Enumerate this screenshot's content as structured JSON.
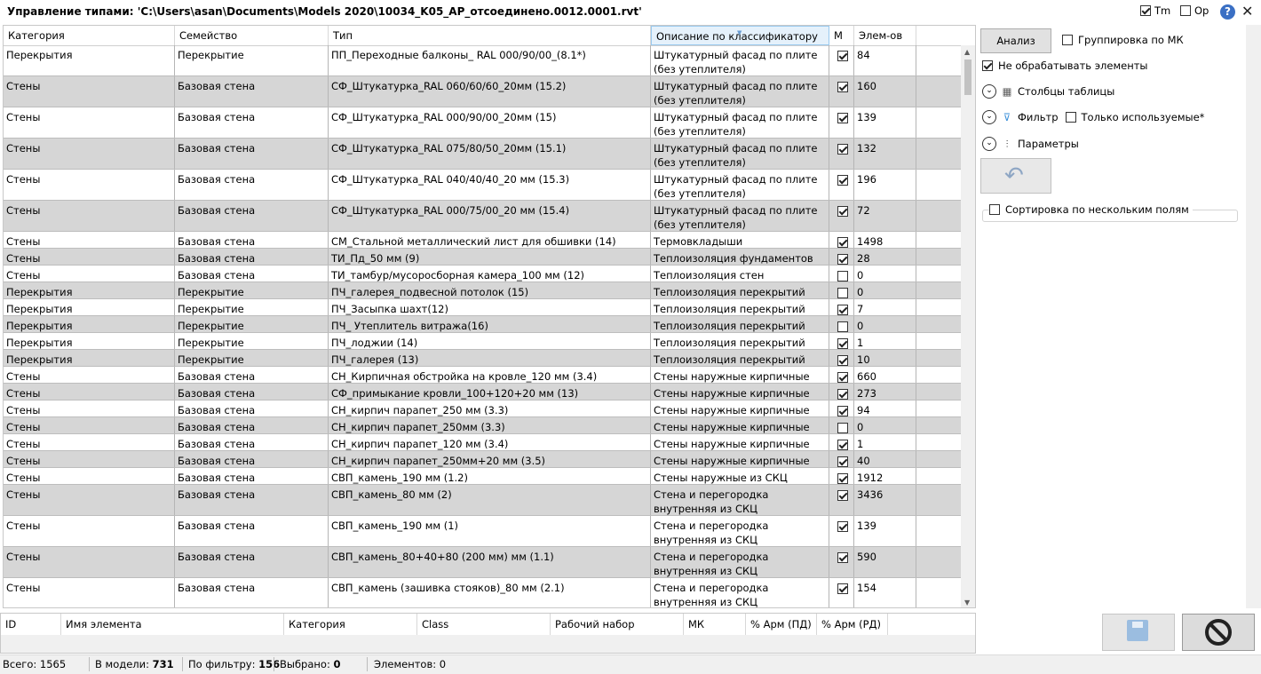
{
  "window": {
    "title": "Управление типами: 'C:\\Users\\asan\\Documents\\Models 2020\\10034_K05_AP_отсоединено.0012.0001.rvt'",
    "tm_label": "Tm",
    "op_label": "Op",
    "help_label": "?",
    "close_label": "✕"
  },
  "grid": {
    "columns": [
      "Категория",
      "Семейство",
      "Тип",
      "Описание по классификатору",
      "M",
      "Элем-ов"
    ],
    "rows": [
      {
        "cat": "Перекрытия",
        "fam": "Перекрытие",
        "type": "ПП_Переходные балконы_ RAL 000/90/00_(8.1*)",
        "desc": "Штукатурный  фасад по плите (без утеплителя)",
        "m": true,
        "n": "84"
      },
      {
        "cat": "Стены",
        "fam": "Базовая стена",
        "type": "СФ_Штукатурка_RAL 060/60/60_20мм (15.2)",
        "desc": "Штукатурный  фасад по плите (без утеплителя)",
        "m": true,
        "n": "160"
      },
      {
        "cat": "Стены",
        "fam": "Базовая стена",
        "type": "СФ_Штукатурка_RAL 000/90/00_20мм (15)",
        "desc": "Штукатурный  фасад по плите (без утеплителя)",
        "m": true,
        "n": "139"
      },
      {
        "cat": "Стены",
        "fam": "Базовая стена",
        "type": "СФ_Штукатурка_RAL 075/80/50_20мм (15.1)",
        "desc": "Штукатурный  фасад по плите (без утеплителя)",
        "m": true,
        "n": "132"
      },
      {
        "cat": "Стены",
        "fam": "Базовая стена",
        "type": "СФ_Штукатурка_RAL 040/40/40_20 мм (15.3)",
        "desc": "Штукатурный  фасад по плите (без утеплителя)",
        "m": true,
        "n": "196"
      },
      {
        "cat": "Стены",
        "fam": "Базовая стена",
        "type": "СФ_Штукатурка_RAL 000/75/00_20 мм (15.4)",
        "desc": "Штукатурный  фасад по плите (без утеплителя)",
        "m": true,
        "n": "72"
      },
      {
        "cat": "Стены",
        "fam": "Базовая стена",
        "type": "СМ_Стальной металлический лист для обшивки (14)",
        "desc": "Термовкладыши",
        "m": true,
        "n": "1498"
      },
      {
        "cat": "Стены",
        "fam": "Базовая стена",
        "type": "ТИ_Пд_50 мм (9)",
        "desc": "Теплоизоляция фундаментов",
        "m": true,
        "n": "28"
      },
      {
        "cat": "Стены",
        "fam": "Базовая стена",
        "type": "ТИ_тамбур/мусоросборная камера_100 мм (12)",
        "desc": "Теплоизоляция стен",
        "m": false,
        "n": "0"
      },
      {
        "cat": "Перекрытия",
        "fam": "Перекрытие",
        "type": "ПЧ_галерея_подвесной потолок (15)",
        "desc": "Теплоизоляция перекрытий",
        "m": false,
        "n": "0"
      },
      {
        "cat": "Перекрытия",
        "fam": "Перекрытие",
        "type": "ПЧ_Засыпка шахт(12)",
        "desc": "Теплоизоляция перекрытий",
        "m": true,
        "n": "7"
      },
      {
        "cat": "Перекрытия",
        "fam": "Перекрытие",
        "type": "ПЧ_ Утеплитель витража(16)",
        "desc": "Теплоизоляция перекрытий",
        "m": false,
        "n": "0"
      },
      {
        "cat": "Перекрытия",
        "fam": "Перекрытие",
        "type": "ПЧ_лоджии (14)",
        "desc": "Теплоизоляция перекрытий",
        "m": true,
        "n": "1"
      },
      {
        "cat": "Перекрытия",
        "fam": "Перекрытие",
        "type": "ПЧ_галерея (13)",
        "desc": "Теплоизоляция перекрытий",
        "m": true,
        "n": "10"
      },
      {
        "cat": "Стены",
        "fam": "Базовая стена",
        "type": "СН_Кирпичная обстройка на кровле_120 мм (3.4)",
        "desc": "Стены наружные кирпичные",
        "m": true,
        "n": "660"
      },
      {
        "cat": "Стены",
        "fam": "Базовая стена",
        "type": "СФ_примыкание кровли_100+120+20 мм (13)",
        "desc": "Стены наружные кирпичные",
        "m": true,
        "n": "273"
      },
      {
        "cat": "Стены",
        "fam": "Базовая стена",
        "type": "СН_кирпич парапет_250 мм (3.3)",
        "desc": "Стены наружные кирпичные",
        "m": true,
        "n": "94"
      },
      {
        "cat": "Стены",
        "fam": "Базовая стена",
        "type": "СН_кирпич парапет_250мм (3.3)",
        "desc": "Стены наружные кирпичные",
        "m": false,
        "n": "0"
      },
      {
        "cat": "Стены",
        "fam": "Базовая стена",
        "type": "СН_кирпич парапет_120 мм (3.4)",
        "desc": "Стены наружные кирпичные",
        "m": true,
        "n": "1"
      },
      {
        "cat": "Стены",
        "fam": "Базовая стена",
        "type": "СН_кирпич парапет_250мм+20 мм (3.5)",
        "desc": "Стены наружные кирпичные",
        "m": true,
        "n": "40"
      },
      {
        "cat": "Стены",
        "fam": "Базовая стена",
        "type": "СВП_камень_190 мм (1.2)",
        "desc": "Стены наружные из СКЦ",
        "m": true,
        "n": "1912"
      },
      {
        "cat": "Стены",
        "fam": "Базовая стена",
        "type": "СВП_камень_80 мм (2)",
        "desc": "Стена и перегородка внутренняя из СКЦ",
        "m": true,
        "n": "3436"
      },
      {
        "cat": "Стены",
        "fam": "Базовая стена",
        "type": "СВП_камень_190 мм (1)",
        "desc": "Стена и перегородка внутренняя из СКЦ",
        "m": true,
        "n": "139"
      },
      {
        "cat": "Стены",
        "fam": "Базовая стена",
        "type": "СВП_камень_80+40+80 (200 мм) мм (1.1)",
        "desc": "Стена и перегородка внутренняя из СКЦ",
        "m": true,
        "n": "590"
      },
      {
        "cat": "Стены",
        "fam": "Базовая стена",
        "type": "СВП_камень (зашивка стояков)_80 мм (2.1)",
        "desc": "Стена и перегородка внутренняя из СКЦ",
        "m": true,
        "n": "154"
      }
    ]
  },
  "subgrid": {
    "columns": [
      "ID",
      "Имя элемента",
      "Категория",
      "Class",
      "Рабочий набор",
      "МК",
      "% Арм (ПД)",
      "% Арм (РД)"
    ]
  },
  "panel": {
    "analyze_label": "Анализ",
    "group_mk_label": "Группировка по МК",
    "no_process_label": "Не обрабатывать элементы",
    "columns_label": "Столбцы таблицы",
    "filter_label": "Фильтр",
    "only_used_label": "Только используемые*",
    "params_label": "Параметры",
    "multi_sort_label": "Сортировка по нескольким полям"
  },
  "status": {
    "total_label": "Всего:",
    "total_value": "1565",
    "model_label": "В модели:",
    "model_value": "731",
    "filter_label": "По фильтру:",
    "filter_value": "156",
    "selected_label": "Выбрано:",
    "selected_value": "0",
    "elements_label": "Элементов:",
    "elements_value": "0"
  }
}
